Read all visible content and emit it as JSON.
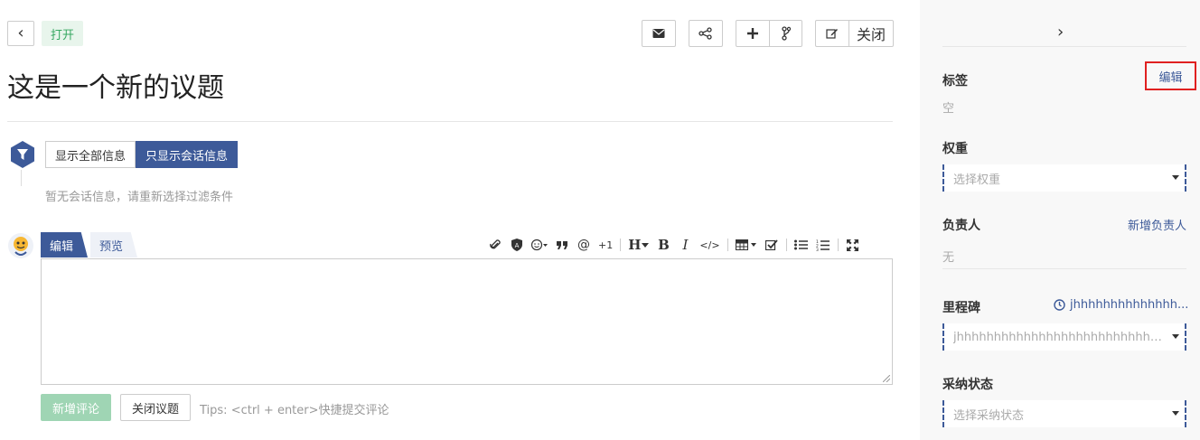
{
  "header": {
    "back_glyph": "‹",
    "status_label": "打开",
    "icons": [
      "envelope-icon",
      "share-icon",
      "plus-icon",
      "branch-icon",
      "edit-icon"
    ],
    "close_label": "关闭"
  },
  "issue": {
    "title": "这是一个新的议题"
  },
  "filter": {
    "show_all_label": "显示全部信息",
    "show_comments_label": "只显示会话信息",
    "empty_hint": "暂无会话信息，请重新选择过滤条件"
  },
  "comment": {
    "tab_edit": "编辑",
    "tab_preview": "预览",
    "toolbar": {
      "plus_one": "+1",
      "heading": "H",
      "bold": "B",
      "italic": "I",
      "code": "</>"
    },
    "submit_label": "新增评论",
    "close_issue_label": "关闭议题",
    "tips": "Tips: <ctrl + enter>快捷提交评论"
  },
  "sidebar": {
    "collapse_glyph": "›",
    "labels": {
      "title": "标签",
      "edit": "编辑",
      "value": "空"
    },
    "weight": {
      "title": "权重",
      "placeholder": "选择权重"
    },
    "assignee": {
      "title": "负责人",
      "add": "新增负责人",
      "value": "无"
    },
    "milestone": {
      "title": "里程碑",
      "link": "jhhhhhhhhhhhhhh...",
      "selected": "jhhhhhhhhhhhhhhhhhhhhhhhhhhhhhhhhhh..."
    },
    "adoption": {
      "title": "采纳状态",
      "placeholder": "选择采纳状态"
    }
  },
  "colors": {
    "primary": "#3d5a99",
    "success": "#37a862",
    "highlight": "#e02020"
  }
}
